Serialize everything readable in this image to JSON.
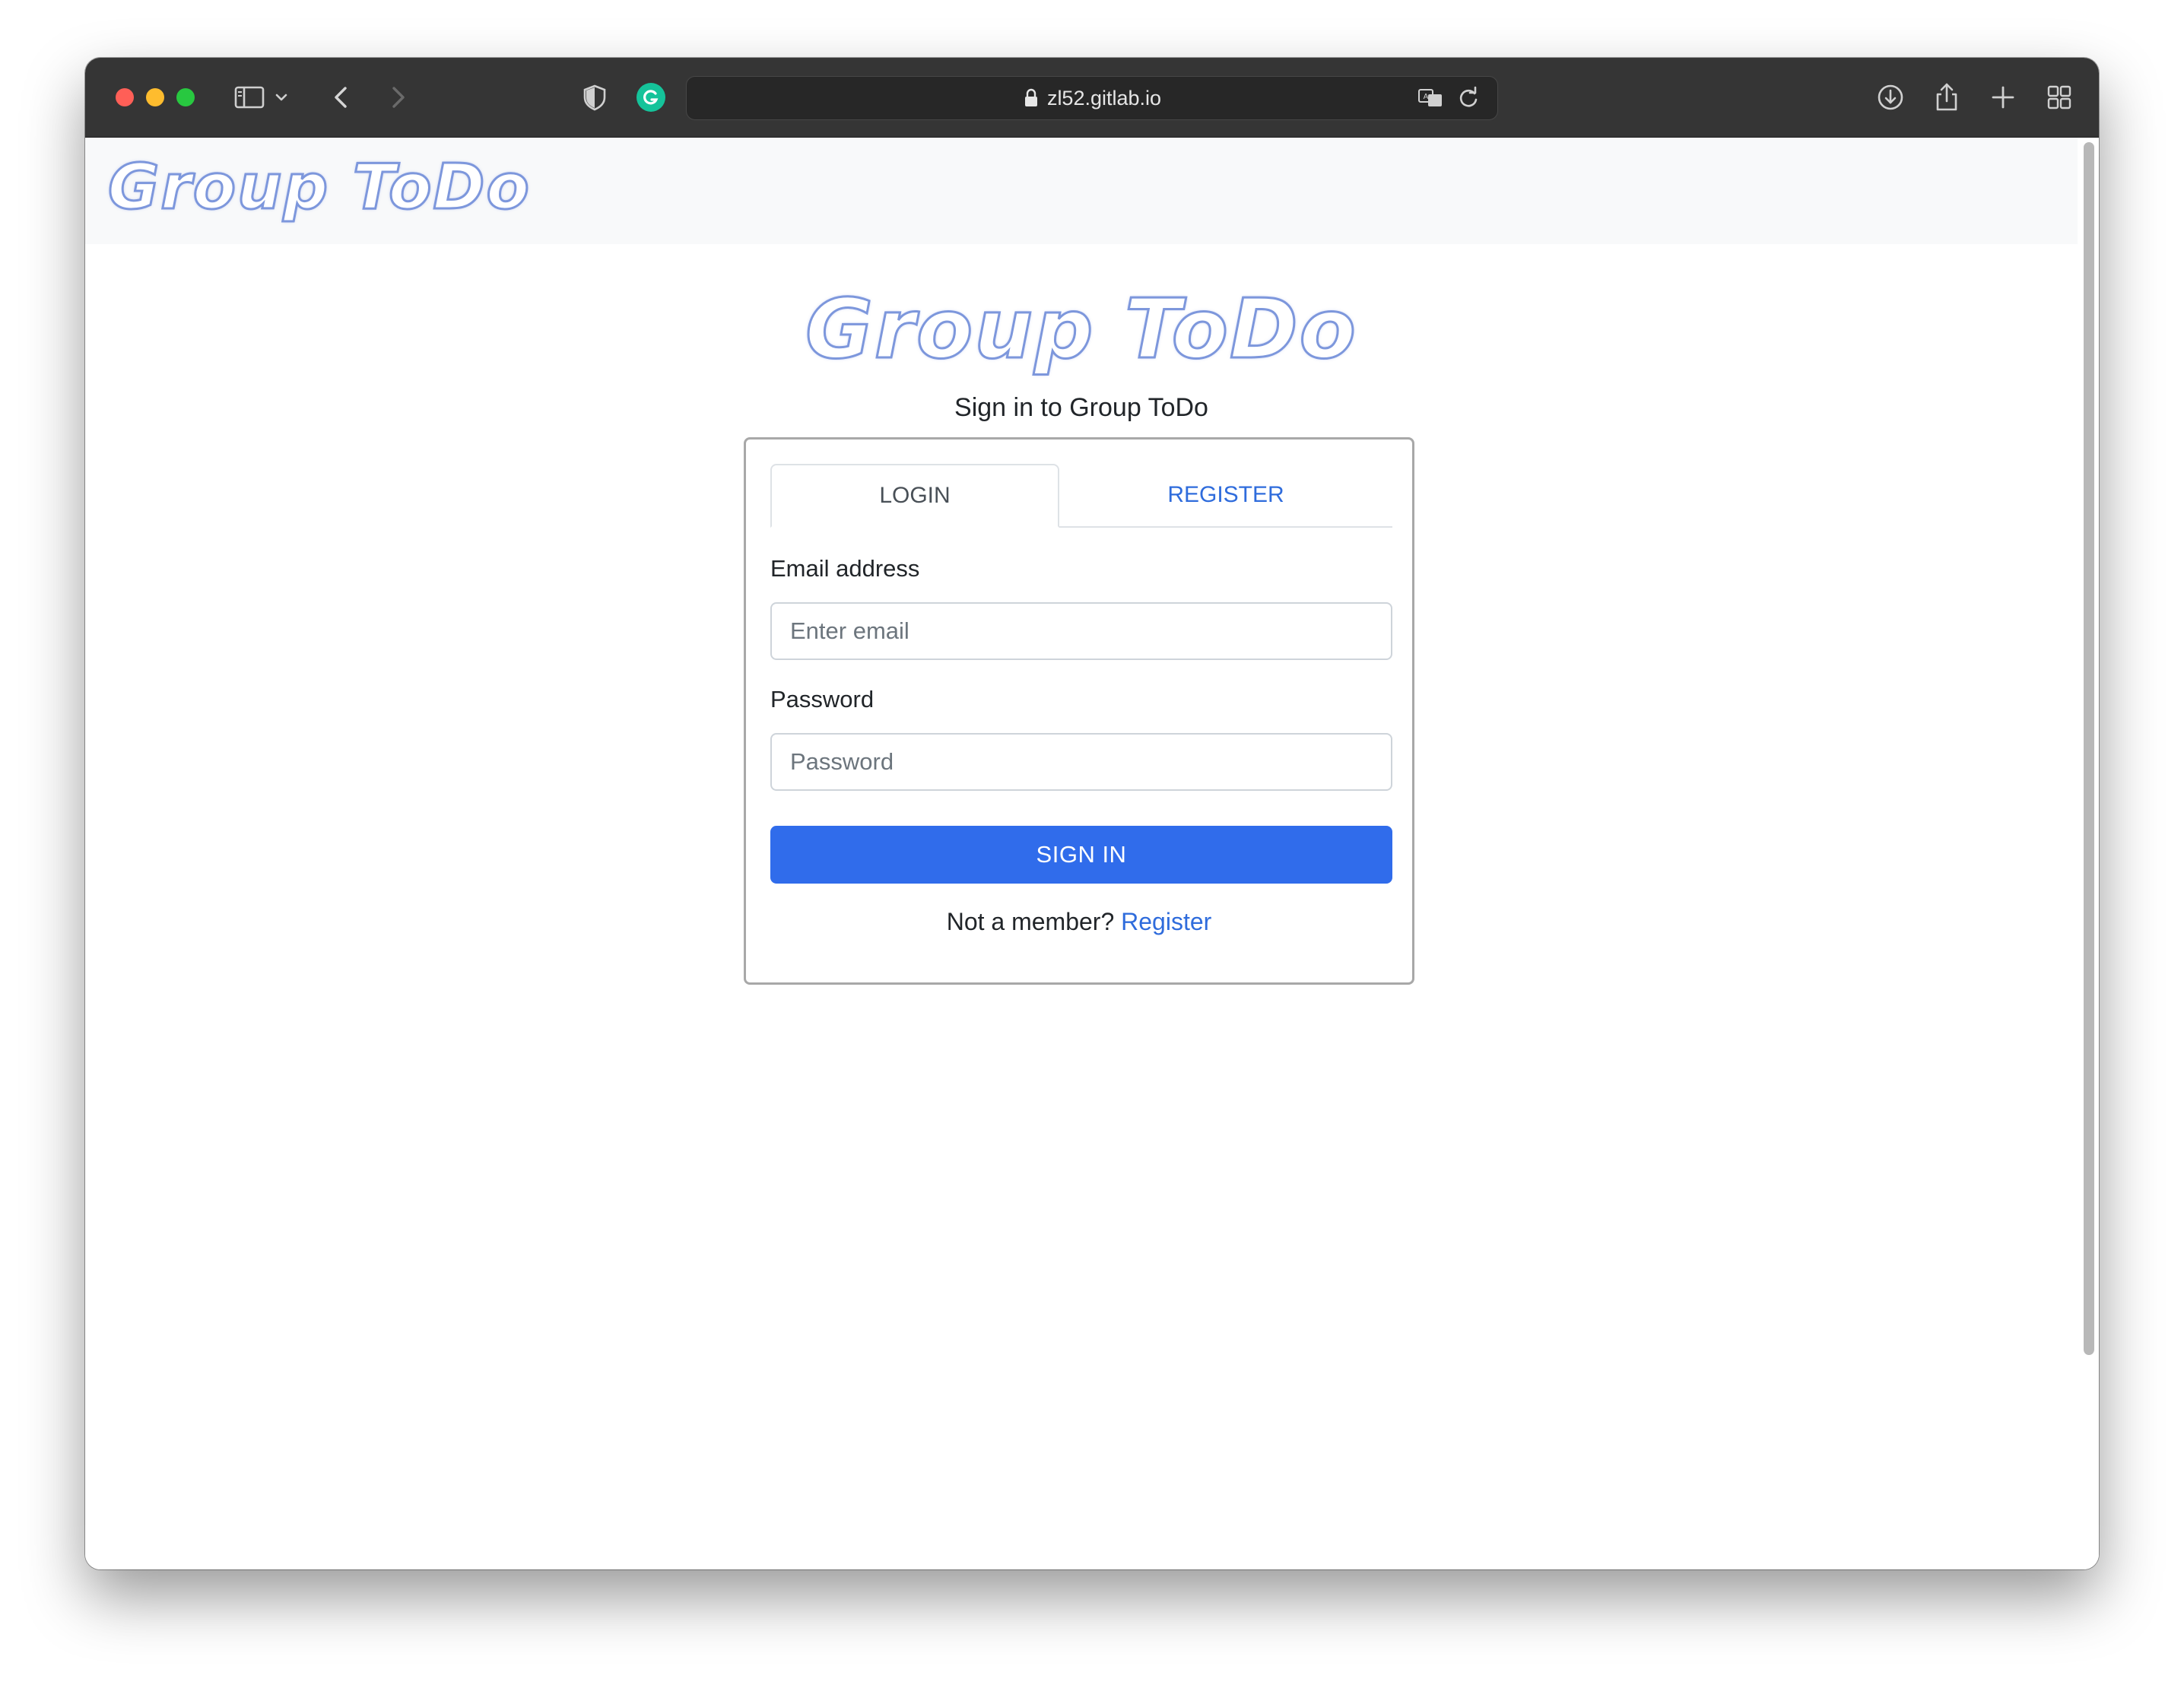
{
  "browser": {
    "url": "zl52.gitlab.io"
  },
  "navbar": {
    "brand": "Group ToDo"
  },
  "main": {
    "logo": "Group ToDo",
    "subtitle": "Sign in to Group ToDo"
  },
  "tabs": [
    {
      "label": "LOGIN",
      "active": true
    },
    {
      "label": "REGISTER",
      "active": false
    }
  ],
  "form": {
    "email_label": "Email address",
    "email_placeholder": "Enter email",
    "email_value": "",
    "password_label": "Password",
    "password_placeholder": "Password",
    "password_value": "",
    "submit_label": "SIGN IN",
    "member_prompt": "Not a member?",
    "register_link": "Register"
  },
  "colors": {
    "primary": "#306ceb",
    "link": "#2f6cdc",
    "logo_outline": "#7d97dc",
    "navbar_bg": "#f8f9fa",
    "toolbar_bg": "#353535"
  },
  "icons": [
    "sidebar-icon",
    "chevron-down-icon",
    "back-icon",
    "forward-icon",
    "shield-icon",
    "grammarly-icon",
    "lock-icon",
    "translate-icon",
    "reload-icon",
    "download-icon",
    "share-icon",
    "new-tab-icon",
    "tab-overview-icon"
  ]
}
